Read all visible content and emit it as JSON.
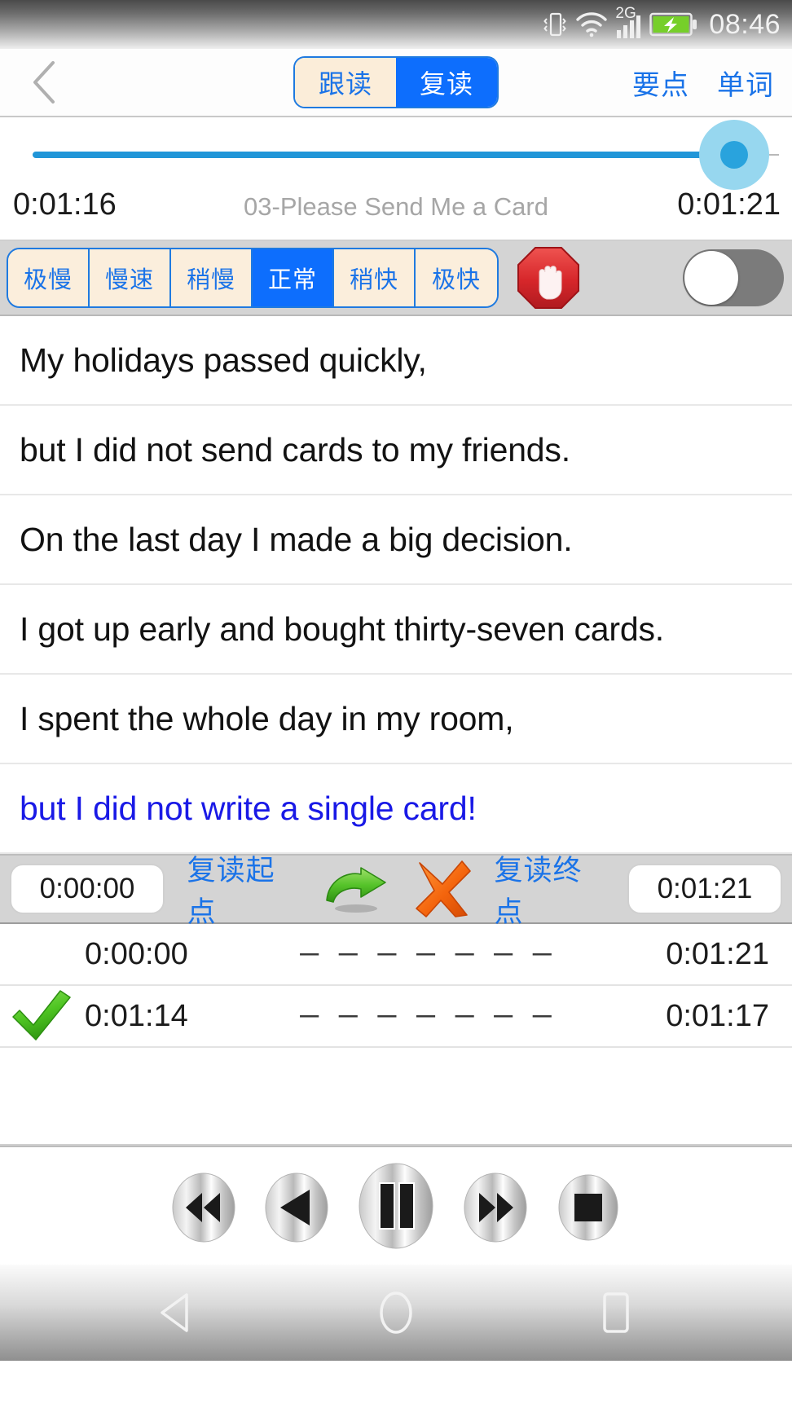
{
  "status_bar": {
    "time": "08:46",
    "icons": [
      "vibrate-icon",
      "wifi-icon",
      "signal-2g-icon",
      "battery-charging-icon"
    ],
    "network_label": "2G"
  },
  "header": {
    "back_icon": "chevron-left-icon",
    "mode_tabs": [
      {
        "label": "跟读",
        "active": false
      },
      {
        "label": "复读",
        "active": true
      }
    ],
    "links": [
      {
        "label": "要点"
      },
      {
        "label": "单词"
      }
    ]
  },
  "player_progress": {
    "title": "03-Please Send Me a Card",
    "current_time": "0:01:16",
    "total_time": "0:01:21",
    "percent": 94
  },
  "speed_bar": {
    "options": [
      {
        "label": "极慢",
        "active": false
      },
      {
        "label": "慢速",
        "active": false
      },
      {
        "label": "稍慢",
        "active": false
      },
      {
        "label": "正常",
        "active": true
      },
      {
        "label": "稍快",
        "active": false
      },
      {
        "label": "极快",
        "active": false
      }
    ],
    "stop_icon": "stop-hand-icon",
    "toggle": {
      "name": "loop-toggle",
      "on": false
    }
  },
  "sentences": [
    {
      "text": "My holidays passed quickly,",
      "highlighted": false
    },
    {
      "text": "but I did not send cards to my friends.",
      "highlighted": false
    },
    {
      "text": "On the last day I made a big decision.",
      "highlighted": false
    },
    {
      "text": "I got up early and bought thirty-seven cards.",
      "highlighted": false
    },
    {
      "text": "I spent the whole day in my room,",
      "highlighted": false
    },
    {
      "text": "but I did not write a single card!",
      "highlighted": true
    }
  ],
  "repeat_bar": {
    "start_value": "0:00:00",
    "start_label": "复读起点",
    "start_icon": "green-curved-arrow-icon",
    "end_icon": "orange-cross-icon",
    "end_label": "复读终点",
    "end_value": "0:01:21"
  },
  "mark_rows": [
    {
      "checked": false,
      "start": "0:00:00",
      "dashes": "— — — — — — —",
      "end": "0:01:21"
    },
    {
      "checked": true,
      "start": "0:01:14",
      "dashes": "— — — — — — —",
      "end": "0:01:17"
    }
  ],
  "player_controls": [
    {
      "name": "rewind-button",
      "icon": "rewind-icon"
    },
    {
      "name": "previous-button",
      "icon": "previous-icon"
    },
    {
      "name": "pause-button",
      "icon": "pause-icon"
    },
    {
      "name": "fast-forward-button",
      "icon": "fast-forward-icon"
    },
    {
      "name": "stop-button",
      "icon": "stop-square-icon"
    }
  ],
  "nav_bar": {
    "buttons": [
      {
        "name": "android-back-button",
        "icon": "triangle-left-icon"
      },
      {
        "name": "android-home-button",
        "icon": "circle-icon"
      },
      {
        "name": "android-recents-button",
        "icon": "square-icon"
      }
    ]
  },
  "colors": {
    "accent_blue": "#1a73e8",
    "active_blue": "#0d6efd",
    "cream": "#fbeedc",
    "slider_blue": "#2196d8",
    "highlight_text": "#1919e6",
    "speed_bar_bg": "#d4d4d4",
    "green": "#4cc126",
    "orange": "#f26a16"
  }
}
